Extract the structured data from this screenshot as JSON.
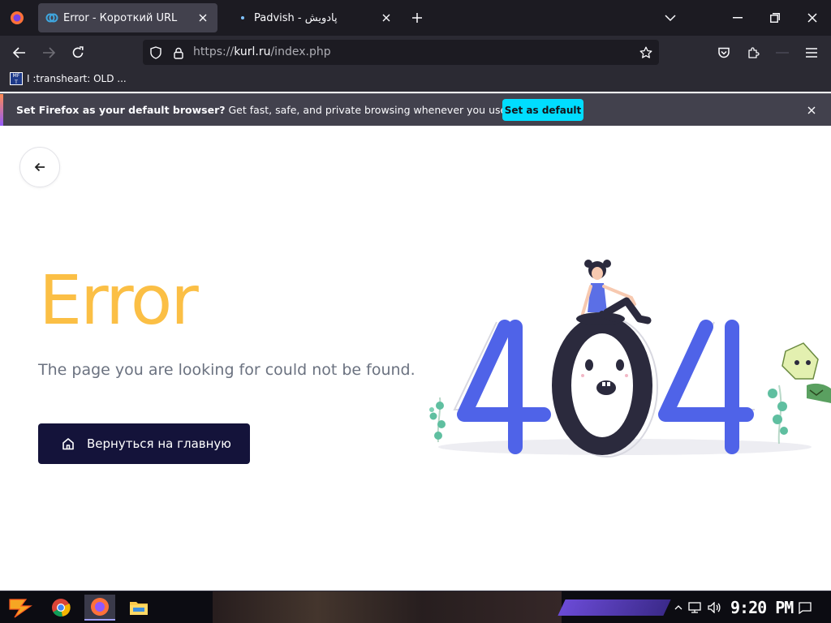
{
  "browser": {
    "tabs": [
      {
        "title": "Error - Короткий URL",
        "active": true
      },
      {
        "title": "Padvish - پادویش",
        "active": false
      }
    ],
    "url": {
      "prefix": "https://",
      "domain": "kurl.ru",
      "path": "/index.php"
    },
    "bookmark": {
      "icon_text": "MF T",
      "label": "I :transheart: OLD ..."
    },
    "notification": {
      "bold": "Set Firefox as your default browser?",
      "text": " Get fast, safe, and private browsing whenever you use the web.",
      "button": "Set as default"
    }
  },
  "page": {
    "title": "Error",
    "subtitle": "The page you are looking for could not be found.",
    "home_button": "Вернуться на главную",
    "illustration_text": "404"
  },
  "colors": {
    "accent_yellow": "#fbbf45",
    "button_navy": "#14133a",
    "digit_blue": "#4f63e8",
    "digit_dark": "#2b2a3d",
    "cta_cyan": "#00ddff"
  },
  "taskbar": {
    "time": "9:20 PM",
    "apps": [
      "start-icon",
      "chrome-icon",
      "firefox-icon",
      "file-explorer-icon"
    ]
  }
}
